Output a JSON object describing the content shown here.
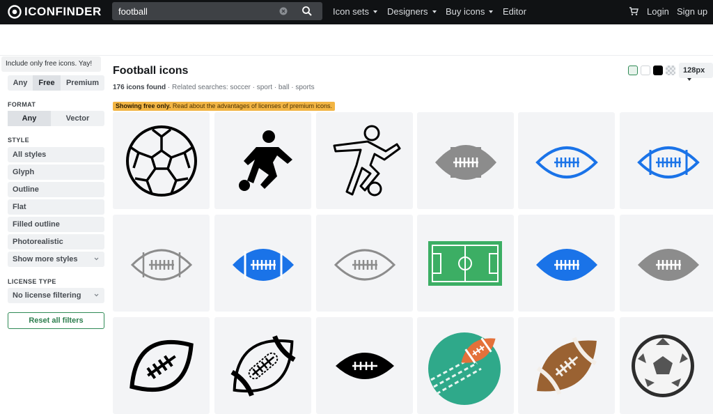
{
  "header": {
    "brand": "ICONFINDER",
    "search_value": "football",
    "nav": [
      "Icon sets",
      "Designers",
      "Buy icons",
      "Editor"
    ],
    "login": "Login",
    "signup": "Sign up",
    "icons": [
      "eye-logo-icon",
      "clear-icon",
      "search-icon",
      "cart-icon"
    ]
  },
  "sidebar": {
    "tooltip": "Include only free icons. Yay!",
    "price": {
      "options": [
        "Any",
        "Free",
        "Premium"
      ],
      "selected": "Free"
    },
    "format": {
      "title": "FORMAT",
      "options": [
        "Any",
        "Vector"
      ],
      "selected": "Any"
    },
    "style": {
      "title": "STYLE",
      "items": [
        "All styles",
        "Glyph",
        "Outline",
        "Flat",
        "Filled outline",
        "Photorealistic",
        "Show more styles"
      ]
    },
    "license": {
      "title": "LICENSE TYPE",
      "value": "No license filtering"
    },
    "reset": "Reset all filters"
  },
  "main": {
    "title": "Football icons",
    "count": "176 icons found",
    "related_label": "· Related searches:",
    "related": [
      "soccer",
      "sport",
      "ball",
      "sports"
    ],
    "banner_strong": "Showing free only.",
    "banner_text": "Read about the advantages of licenses of premium icons.",
    "size": "128px",
    "swatches": [
      "#e8f3ec",
      "#ffffff",
      "#000000",
      "checker"
    ],
    "icons": [
      "soccer-ball-outline-icon",
      "soccer-player-glyph-icon",
      "soccer-player-outline-icon",
      "football-gray-icon",
      "football-blue-outline-icon",
      "football-blue-outline-2-icon",
      "football-gray-outline-icon",
      "football-blue-filled-icon",
      "football-gray-outline-2-icon",
      "soccer-field-icon",
      "football-blue-solid-icon",
      "football-gray-solid-icon",
      "football-black-outline-icon",
      "football-black-detailed-icon",
      "football-black-solid-icon",
      "football-field-circle-icon",
      "football-brown-icon",
      "soccer-ball-gray-icon"
    ]
  }
}
